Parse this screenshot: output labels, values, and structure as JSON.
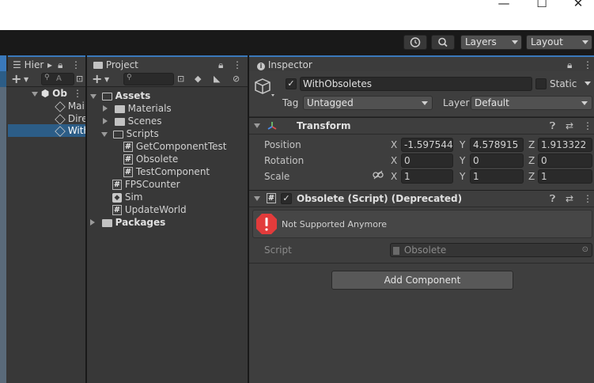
{
  "window_controls": {
    "minimize": "—",
    "maximize": "☐",
    "close": "✕"
  },
  "toolbar": {
    "history_icon": "history-icon",
    "search_icon": "search-icon",
    "layers_label": "Layers",
    "layout_label": "Layout"
  },
  "hierarchy": {
    "tab_label": "Hier",
    "search_placeholder": "A",
    "items": [
      {
        "label": "Ob"
      },
      {
        "label": "Mai"
      },
      {
        "label": "Dire"
      },
      {
        "label": "With"
      }
    ]
  },
  "project": {
    "tab_label": "Project",
    "search_placeholder": "",
    "tree": [
      {
        "label": "Assets"
      },
      {
        "label": "Materials"
      },
      {
        "label": "Scenes"
      },
      {
        "label": "Scripts"
      },
      {
        "label": "GetComponentTest"
      },
      {
        "label": "Obsolete"
      },
      {
        "label": "TestComponent"
      },
      {
        "label": "FPSCounter"
      },
      {
        "label": "Sim"
      },
      {
        "label": "UpdateWorld"
      },
      {
        "label": "Packages"
      }
    ]
  },
  "inspector": {
    "tab_label": "Inspector",
    "object_name": "WithObsoletes",
    "static_label": "Static",
    "tag_label": "Tag",
    "tag_value": "Untagged",
    "layer_label": "Layer",
    "layer_value": "Default",
    "transform": {
      "title": "Transform",
      "position_label": "Position",
      "rotation_label": "Rotation",
      "scale_label": "Scale",
      "axis_x": "X",
      "axis_y": "Y",
      "axis_z": "Z",
      "position": {
        "x": "-1.597544",
        "y": "4.578915",
        "z": "1.913322"
      },
      "rotation": {
        "x": "0",
        "y": "0",
        "z": "0"
      },
      "scale": {
        "x": "1",
        "y": "1",
        "z": "1"
      }
    },
    "obsolete": {
      "title": "Obsolete (Script) (Deprecated)",
      "warning": "Not Supported Anymore",
      "script_label": "Script",
      "script_value": "Obsolete"
    },
    "add_component_label": "Add Component"
  },
  "colors": {
    "accent_blue": "#3a79bb",
    "selection": "#2c5d87",
    "error_red": "#e23b3b"
  }
}
